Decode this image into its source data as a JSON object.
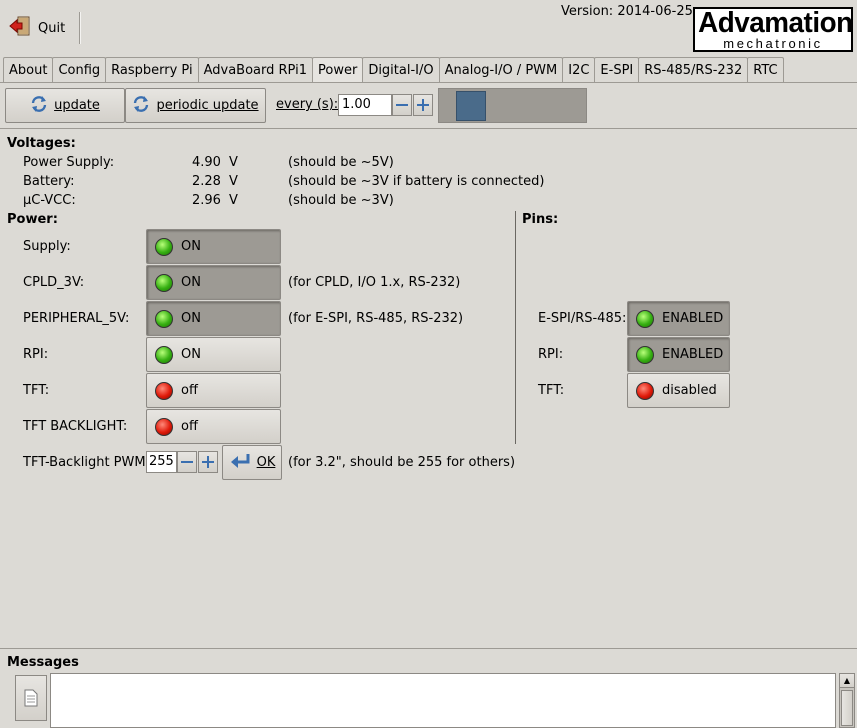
{
  "header": {
    "quit_label": "Quit",
    "version": "Version: 2014-06-25",
    "logo_main": "Advamation",
    "logo_sub": "mechatronic"
  },
  "tabs": [
    {
      "label": "About"
    },
    {
      "label": "Config"
    },
    {
      "label": "Raspberry Pi"
    },
    {
      "label": "AdvaBoard RPi1"
    },
    {
      "label": "Power",
      "active": true
    },
    {
      "label": "Digital-I/O"
    },
    {
      "label": "Analog-I/O / PWM"
    },
    {
      "label": "I2C"
    },
    {
      "label": "E-SPI"
    },
    {
      "label": "RS-485/RS-232"
    },
    {
      "label": "RTC"
    }
  ],
  "toolbar": {
    "update_label": "update",
    "periodic_label": "periodic update",
    "every_label": "every (s):",
    "every_value": "1.00",
    "progress_fraction": 0.2
  },
  "voltages": {
    "title": "Voltages:",
    "rows": [
      {
        "label": "Power Supply:",
        "value": "4.90",
        "unit": "V",
        "note": "(should be ~5V)"
      },
      {
        "label": "Battery:",
        "value": "2.28",
        "unit": "V",
        "note": "(should be ~3V if battery is connected)"
      },
      {
        "label": "µC-VCC:",
        "value": "2.96",
        "unit": "V",
        "note": "(should be ~3V)"
      }
    ]
  },
  "power": {
    "title": "Power:",
    "rows": [
      {
        "label": "Supply:",
        "state": "ON",
        "led": "green",
        "pressed": true,
        "note": ""
      },
      {
        "label": "CPLD_3V:",
        "state": "ON",
        "led": "green",
        "pressed": true,
        "note": "(for CPLD, I/O 1.x, RS-232)"
      },
      {
        "label": "PERIPHERAL_5V:",
        "state": "ON",
        "led": "green",
        "pressed": true,
        "note": "(for E-SPI, RS-485, RS-232)"
      },
      {
        "label": "RPI:",
        "state": "ON",
        "led": "green",
        "pressed": false,
        "note": ""
      },
      {
        "label": "TFT:",
        "state": "off",
        "led": "red",
        "pressed": false,
        "note": ""
      },
      {
        "label": "TFT BACKLIGHT:",
        "state": "off",
        "led": "red",
        "pressed": false,
        "note": ""
      }
    ],
    "pwm": {
      "label": "TFT-Backlight PWM:",
      "value": "255",
      "ok_label": "OK",
      "note": "(for 3.2\", should be 255 for others)"
    }
  },
  "pins": {
    "title": "Pins:",
    "rows": [
      {
        "label": "E-SPI/RS-485:",
        "state": "ENABLED",
        "led": "green",
        "pressed": true
      },
      {
        "label": "RPI:",
        "state": "ENABLED",
        "led": "green",
        "pressed": true
      },
      {
        "label": "TFT:",
        "state": "disabled",
        "led": "red",
        "pressed": false
      }
    ]
  },
  "messages": {
    "title": "Messages",
    "content": ""
  },
  "icons": {
    "quit": "quit-icon",
    "refresh": "refresh-icon",
    "ok": "enter-icon",
    "messages": "document-icon"
  },
  "colors": {
    "background": "#dcdad5",
    "pressed": "#9d9a94",
    "led_on": "#36b012",
    "led_off": "#e01a0a",
    "progress": "#4a6b8a"
  }
}
